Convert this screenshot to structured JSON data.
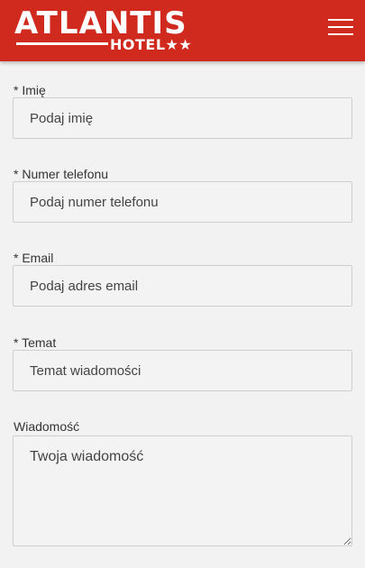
{
  "header": {
    "logo_title": "ATLANTIS",
    "logo_subtitle": "HOTEL★★",
    "menu_icon": "hamburger-menu-icon",
    "background": "#d02a1f"
  },
  "form": {
    "name": {
      "label": "* Imię",
      "placeholder": "Podaj imię"
    },
    "phone": {
      "label": "* Numer telefonu",
      "placeholder": "Podaj numer telefonu"
    },
    "email": {
      "label": "* Email",
      "placeholder": "Podaj adres email"
    },
    "subject": {
      "label": "* Temat",
      "placeholder": "Temat wiadomości"
    },
    "message": {
      "label": "Wiadomość",
      "placeholder": "Twoja wiadomość"
    }
  }
}
